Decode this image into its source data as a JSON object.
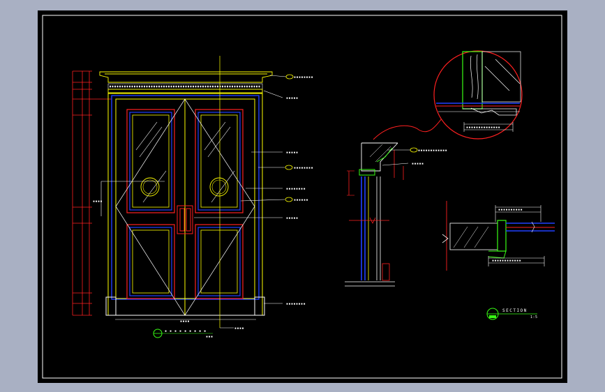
{
  "drawing": {
    "background": "#000000",
    "frame_color": "#a9b0c3",
    "layer_colors": {
      "outline": "#ffff00",
      "panel": "#ff2020",
      "glass_frame": "#2040ff",
      "detail": "#39ff14",
      "dimension": "#ffffff",
      "highlight": "#00ffff",
      "leader": "#ffffff"
    }
  },
  "labels": {
    "section_title": "SECTION",
    "section_scale": "1:5"
  }
}
